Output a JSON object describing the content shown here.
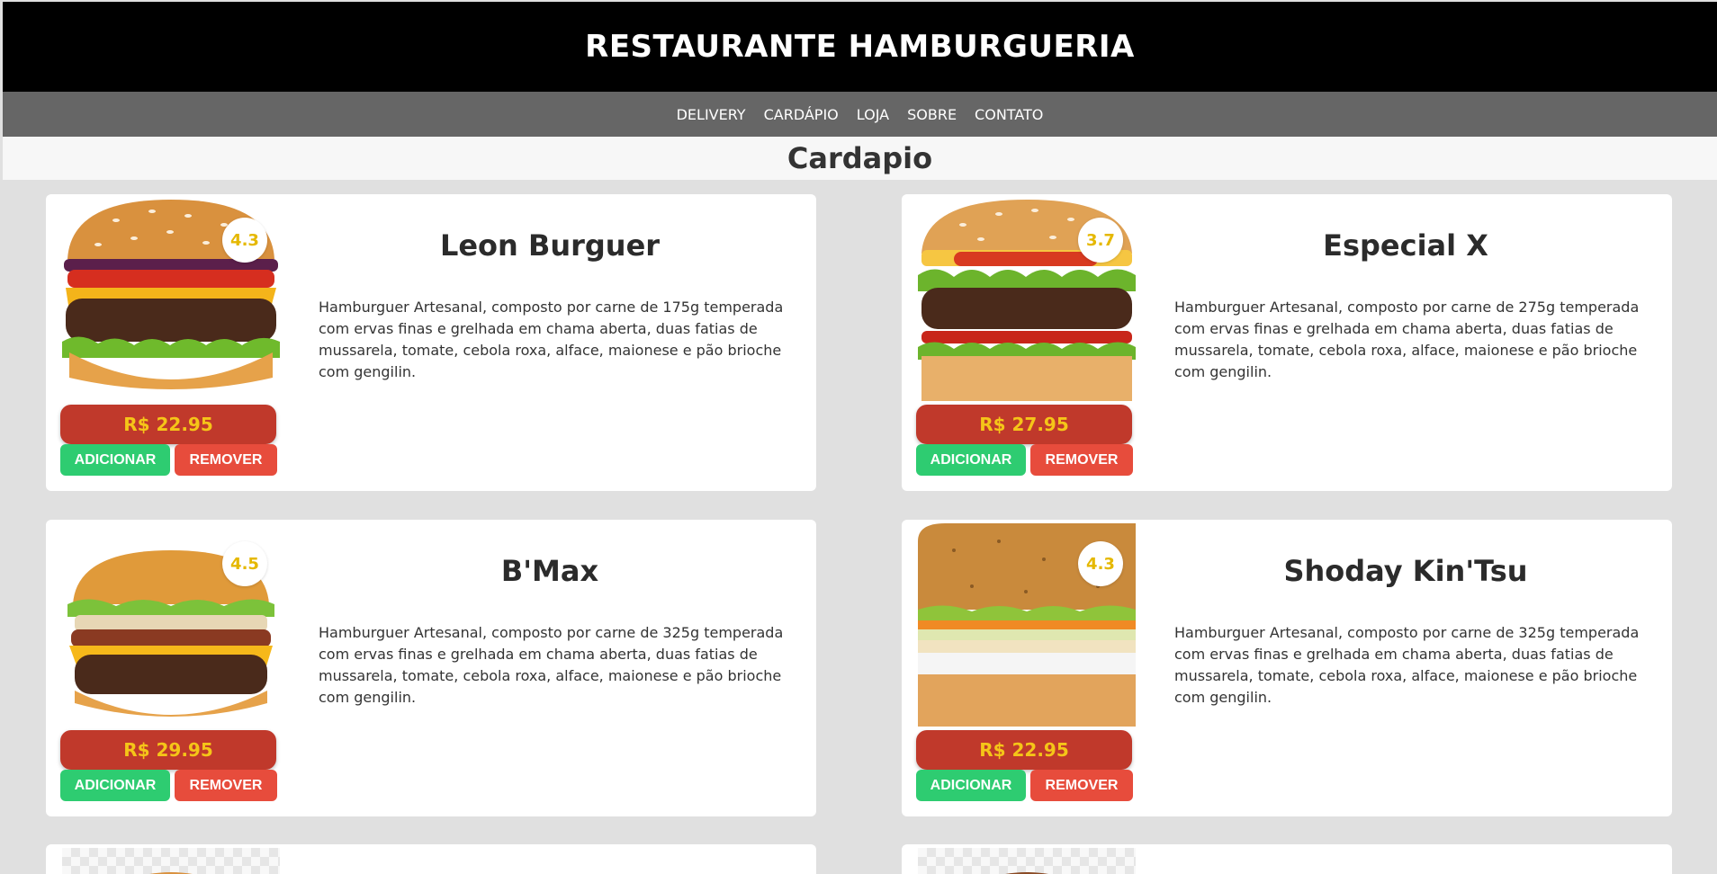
{
  "header": {
    "title": "RESTAURANTE HAMBURGUERIA"
  },
  "nav": {
    "items": [
      "DELIVERY",
      "CARDÁPIO",
      "LOJA",
      "SOBRE",
      "CONTATO"
    ]
  },
  "section": {
    "title": "Cardapio"
  },
  "colors": {
    "header_bg": "#000000",
    "nav_bg": "#666666",
    "price_bg": "#c0392b",
    "price_text": "#f5c518",
    "add_button": "#2ecc71",
    "remove_button": "#e74c3c",
    "rating_text": "#e5b800"
  },
  "products": [
    {
      "name": "Leon Burguer",
      "rating": "4.3",
      "price": "R$ 22.95",
      "description": "Hamburguer Artesanal, composto por carne de 175g temperada com ervas finas e grelhada em chama aberta, duas fatias de mussarela, tomate, cebola roxa, alface, maionese e pão brioche com gengilin.",
      "add_label": "ADICIONAR",
      "remove_label": "REMOVER"
    },
    {
      "name": "Especial X",
      "rating": "3.7",
      "price": "R$ 27.95",
      "description": "Hamburguer Artesanal, composto por carne de 275g temperada com ervas finas e grelhada em chama aberta, duas fatias de mussarela, tomate, cebola roxa, alface, maionese e pão brioche com gengilin.",
      "add_label": "ADICIONAR",
      "remove_label": "REMOVER"
    },
    {
      "name": "B'Max",
      "rating": "4.5",
      "price": "R$ 29.95",
      "description": "Hamburguer Artesanal, composto por carne de 325g temperada com ervas finas e grelhada em chama aberta, duas fatias de mussarela, tomate, cebola roxa, alface, maionese e pão brioche com gengilin.",
      "add_label": "ADICIONAR",
      "remove_label": "REMOVER"
    },
    {
      "name": "Shoday Kin'Tsu",
      "rating": "4.3",
      "price": "R$ 22.95",
      "description": "Hamburguer Artesanal, composto por carne de 325g temperada com ervas finas e grelhada em chama aberta, duas fatias de mussarela, tomate, cebola roxa, alface, maionese e pão brioche com gengilin.",
      "add_label": "ADICIONAR",
      "remove_label": "REMOVER"
    }
  ]
}
